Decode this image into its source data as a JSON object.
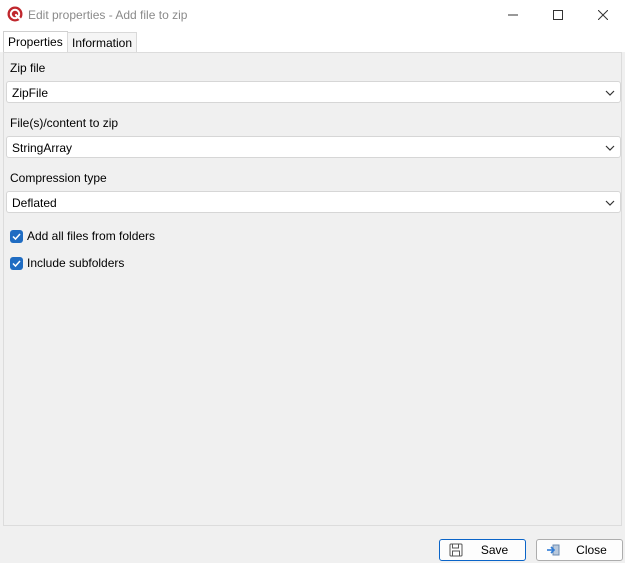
{
  "window": {
    "title": "Edit properties - Add file to zip"
  },
  "tabs": [
    {
      "label": "Properties",
      "active": true
    },
    {
      "label": "Information",
      "active": false
    }
  ],
  "fields": {
    "zip_file": {
      "label": "Zip file",
      "value": "ZipFile"
    },
    "content": {
      "label": "File(s)/content to zip",
      "value": "StringArray"
    },
    "compression": {
      "label": "Compression type",
      "value": "Deflated"
    }
  },
  "checkboxes": [
    {
      "label": "Add all files from folders",
      "checked": true
    },
    {
      "label": "Include subfolders",
      "checked": true
    }
  ],
  "buttons": {
    "save": "Save",
    "close": "Close"
  },
  "colors": {
    "accent": "#1f6cc2",
    "app_icon": "#c0272d"
  }
}
